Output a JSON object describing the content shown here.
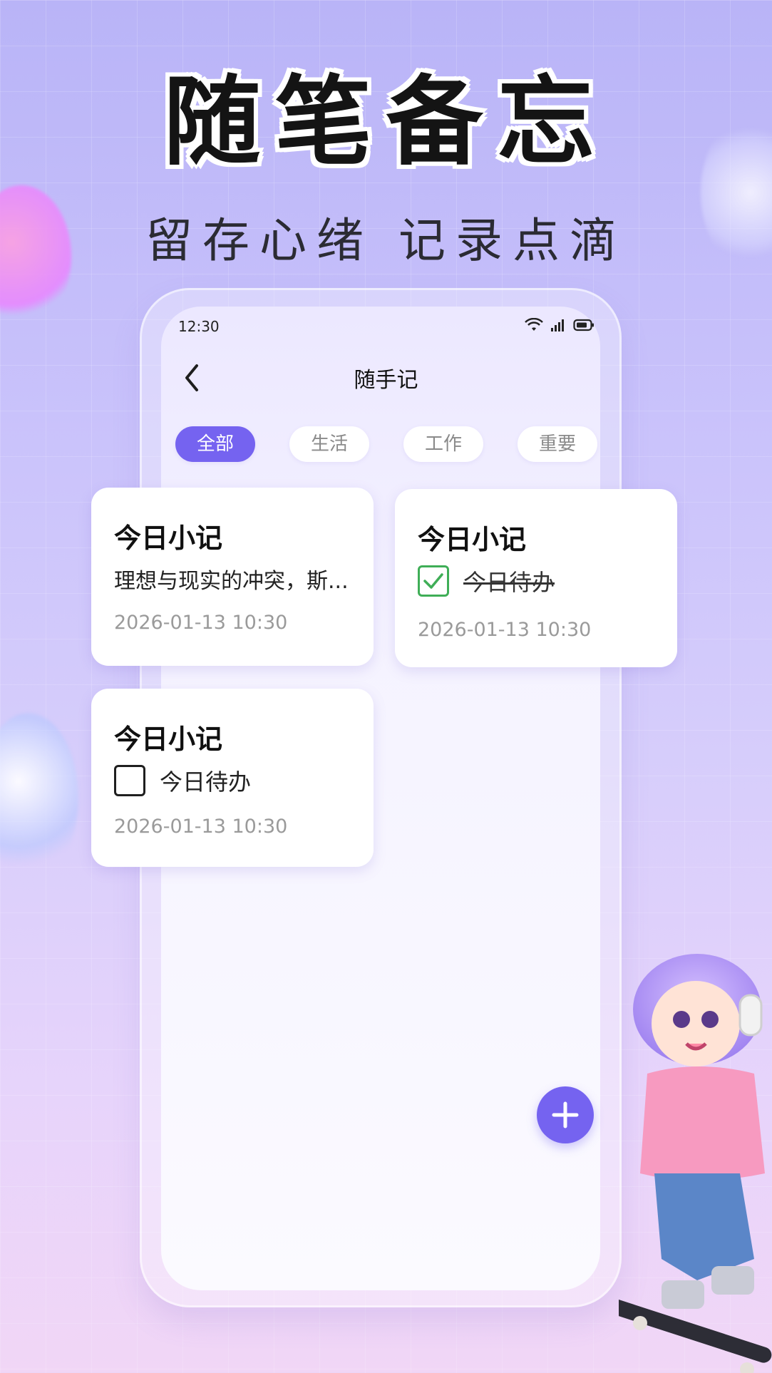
{
  "promo": {
    "title": "随笔备忘",
    "subtitle": "留存心绪 记录点滴"
  },
  "status_bar": {
    "time": "12:30",
    "icons": [
      "wifi-icon",
      "signal-icon",
      "battery-icon"
    ]
  },
  "header": {
    "title": "随手记",
    "back_icon": "chevron-left-icon"
  },
  "tabs": [
    {
      "label": "全部",
      "active": true
    },
    {
      "label": "生活",
      "active": false
    },
    {
      "label": "工作",
      "active": false
    },
    {
      "label": "重要",
      "active": false
    }
  ],
  "notes": [
    {
      "title": "今日小记",
      "body": "理想与现实的冲突，斯...",
      "date": "2026-01-13 10:30"
    },
    {
      "title": "今日小记",
      "todo": {
        "text": "今日待办",
        "checked": true
      },
      "date": "2026-01-13 10:30"
    },
    {
      "title": "今日小记",
      "todo": {
        "text": "今日待办",
        "checked": false
      },
      "date": "2026-01-13 10:30"
    }
  ],
  "fab": {
    "icon": "plus-icon"
  },
  "colors": {
    "accent": "#7563f0",
    "check": "#3fae57",
    "background_top": "#b9b4f7",
    "background_bottom": "#f1d6f6"
  }
}
